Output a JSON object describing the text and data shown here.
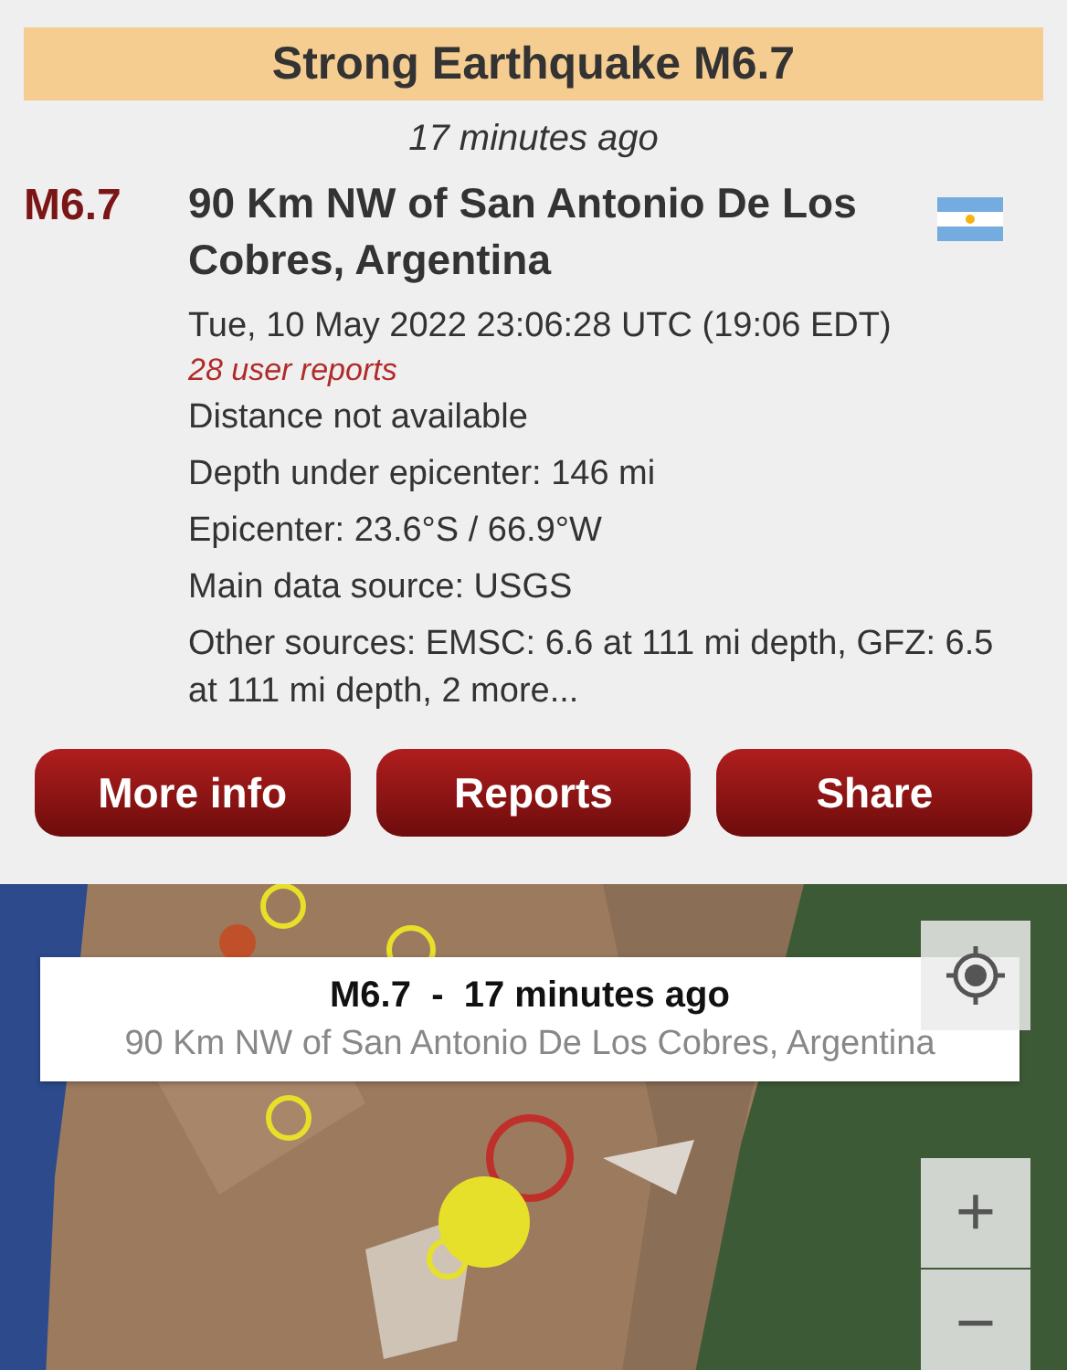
{
  "banner": {
    "title": "Strong Earthquake M6.7"
  },
  "time_ago": "17 minutes ago",
  "event": {
    "magnitude": "M6.7",
    "location": "90 Km NW of San Antonio De Los Cobres, Argentina",
    "datetime": "Tue, 10 May 2022 23:06:28 UTC (19:06 EDT)",
    "user_reports": "28 user reports",
    "details": [
      "Distance not available",
      "Depth under epicenter: 146 mi",
      "Epicenter: 23.6°S / 66.9°W",
      "Main data source: USGS",
      "Other sources: EMSC: 6.6 at 111 mi depth, GFZ: 6.5 at 111 mi depth, 2 more..."
    ]
  },
  "buttons": [
    "More info",
    "Reports",
    "Share"
  ],
  "map": {
    "kind": "picture",
    "popup": {
      "title": "M6.7  -  17 minutes ago",
      "subtitle": "90 Km NW of San Antonio De Los Cobres, Argentina"
    },
    "zoom_in": "+",
    "zoom_out": "−"
  }
}
